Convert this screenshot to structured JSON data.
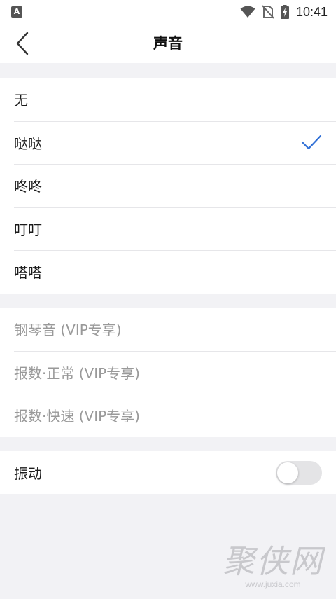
{
  "status_bar": {
    "time": "10:41",
    "left_icon_letter": "A",
    "icons": [
      "wifi-icon",
      "no-sim-icon",
      "battery-charging-icon"
    ]
  },
  "header": {
    "title": "声音",
    "back_icon": "chevron-left-icon"
  },
  "sound_options": [
    {
      "label": "无",
      "selected": false
    },
    {
      "label": "哒哒",
      "selected": true
    },
    {
      "label": "咚咚",
      "selected": false
    },
    {
      "label": "叮叮",
      "selected": false
    },
    {
      "label": "嗒嗒",
      "selected": false
    }
  ],
  "vip_options": [
    {
      "label": "钢琴音 (VIP专享)"
    },
    {
      "label": "报数·正常 (VIP专享)"
    },
    {
      "label": "报数·快速 (VIP专享)"
    }
  ],
  "vibration": {
    "label": "振动",
    "enabled": false
  },
  "watermark": {
    "text": "聚侠网",
    "url": "www.juxia.com"
  },
  "colors": {
    "accent": "#2f6fd6",
    "background": "#f2f2f5",
    "disabled_text": "#999999"
  }
}
